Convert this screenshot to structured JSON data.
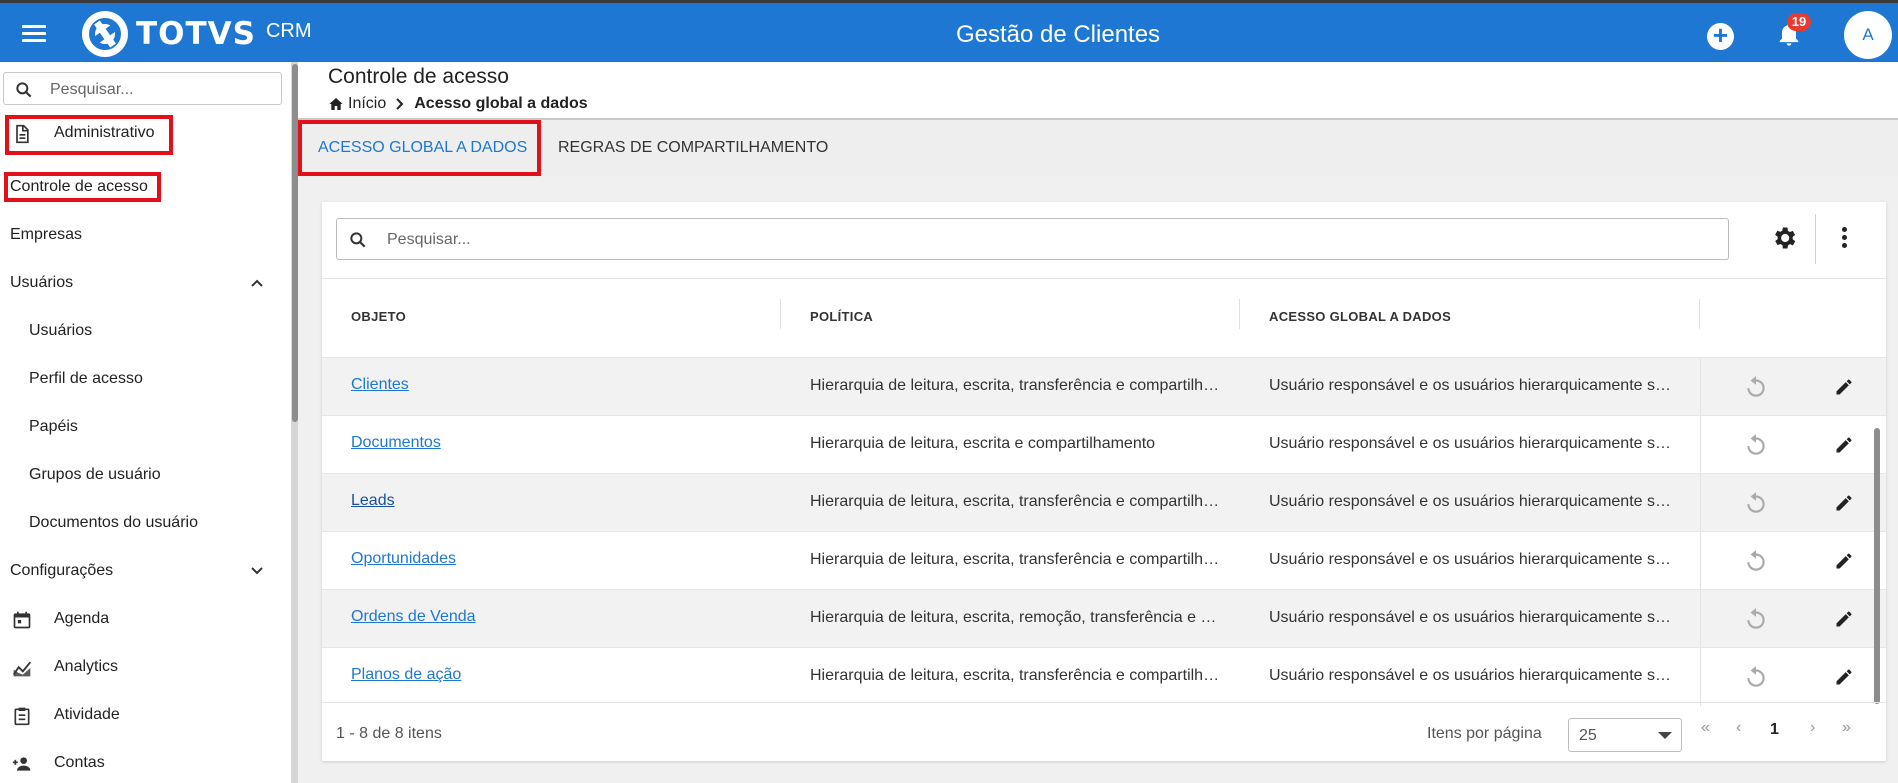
{
  "header": {
    "logo_text": "TOTVS",
    "logo_sub": "CRM",
    "title": "Gestão de Clientes",
    "notification_count": "19",
    "avatar_initial": "A"
  },
  "sidebar": {
    "search_placeholder": "Pesquisar...",
    "items": [
      {
        "label": "Administrativo",
        "icon": "document-icon"
      },
      {
        "label": "Controle de acesso"
      },
      {
        "label": "Empresas"
      },
      {
        "label": "Usuários",
        "expanded": true
      },
      {
        "label": "Usuários"
      },
      {
        "label": "Perfil de acesso"
      },
      {
        "label": "Papéis"
      },
      {
        "label": "Grupos de usuário"
      },
      {
        "label": "Documentos do usuário"
      },
      {
        "label": "Configurações",
        "expanded": false
      },
      {
        "label": "Agenda",
        "icon": "calendar-icon"
      },
      {
        "label": "Analytics",
        "icon": "analytics-icon"
      },
      {
        "label": "Atividade",
        "icon": "clipboard-icon"
      },
      {
        "label": "Contas",
        "icon": "people-icon"
      }
    ]
  },
  "page": {
    "title": "Controle de acesso",
    "breadcrumb": {
      "home": "Início",
      "current": "Acesso global a dados"
    }
  },
  "tabs": [
    {
      "label": "ACESSO GLOBAL A DADOS",
      "active": true
    },
    {
      "label": "REGRAS DE COMPARTILHAMENTO",
      "active": false
    }
  ],
  "table": {
    "search_placeholder": "Pesquisar...",
    "columns": [
      "OBJETO",
      "POLÍTICA",
      "ACESSO GLOBAL A DADOS"
    ],
    "rows": [
      {
        "objeto": "Clientes",
        "politica": "Hierarquia de leitura, escrita, transferência e compartilhamento",
        "acesso": "Usuário responsável e os usuários hierarquicamente superiores"
      },
      {
        "objeto": "Documentos",
        "politica": "Hierarquia de leitura, escrita e compartilhamento",
        "acesso": "Usuário responsável e os usuários hierarquicamente superiores"
      },
      {
        "objeto": "Leads",
        "politica": "Hierarquia de leitura, escrita, transferência e compartilhamento",
        "acesso": "Usuário responsável e os usuários hierarquicamente superiores"
      },
      {
        "objeto": "Oportunidades",
        "politica": "Hierarquia de leitura, escrita, transferência e compartilhamento",
        "acesso": "Usuário responsável e os usuários hierarquicamente superiores"
      },
      {
        "objeto": "Ordens de Venda",
        "politica": "Hierarquia de leitura, escrita, remoção, transferência e compartilhamento",
        "acesso": "Usuário responsável e os usuários hierarquicamente superiores"
      },
      {
        "objeto": "Planos de ação",
        "politica": "Hierarquia de leitura, escrita, transferência e compartilhamento",
        "acesso": "Usuário responsável e os usuários hierarquicamente superiores"
      }
    ]
  },
  "pagination": {
    "count_text": "1 - 8 de 8 itens",
    "per_page_label": "Itens por página",
    "per_page_value": "25",
    "current_page": "1",
    "first": "«",
    "prev": "‹",
    "next": "›",
    "last": "»"
  },
  "colors": {
    "primary": "#1e78d3",
    "highlight_box": "#e1101b",
    "badge": "#e63b2e"
  }
}
